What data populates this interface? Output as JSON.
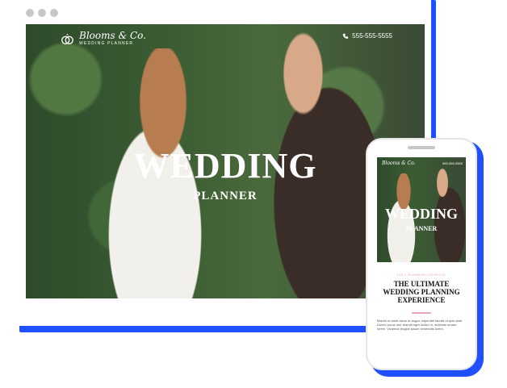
{
  "desktop": {
    "brand_name": "Blooms & Co.",
    "brand_sub": "WEDDING PLANNER",
    "phone": "555-555-5555",
    "hero_title": "WEDDING",
    "hero_subtitle": "PLANNER"
  },
  "mobile": {
    "brand_name": "Blooms & Co.",
    "phone": "555-555-5555",
    "hero_title": "WEDDING",
    "hero_subtitle": "PLANNER",
    "kicker": "FULL PLANNING SERVICE",
    "heading": "THE ULTIMATE WEDDING PLANNING EXPERIENCE",
    "body": "Mauris ut amet lacus et augue imperdiet iaculis ut quis ante. Donec purus nisl, blandit eget luctus ut, molestie ornare lorem. Vivamus feugiat ipsum venenatis lorem."
  },
  "colors": {
    "accent": "#1f4fff",
    "kicker": "#e7a3b7"
  }
}
